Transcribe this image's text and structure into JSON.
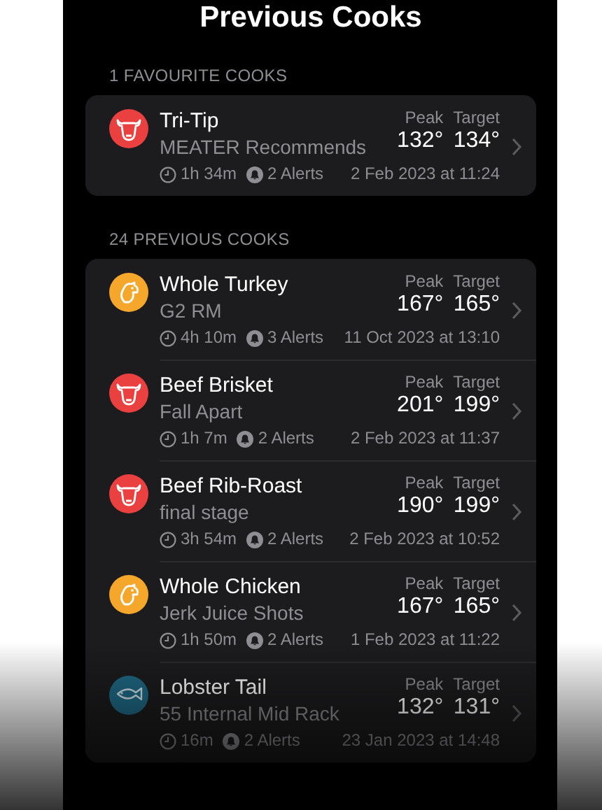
{
  "title": "Previous Cooks",
  "sections": [
    {
      "heading": "1 FAVOURITE COOKS",
      "cooks": [
        {
          "kind": "beef",
          "name": "Tri-Tip",
          "subtitle": "MEATER Recommends",
          "peak_label": "Peak",
          "peak": "132°",
          "target_label": "Target",
          "target": "134°",
          "duration": "1h 34m",
          "alerts": "2 Alerts",
          "date": "2 Feb 2023 at 11:24"
        }
      ]
    },
    {
      "heading": "24 PREVIOUS COOKS",
      "cooks": [
        {
          "kind": "poultry",
          "name": "Whole Turkey",
          "subtitle": "G2 RM",
          "peak_label": "Peak",
          "peak": "167°",
          "target_label": "Target",
          "target": "165°",
          "duration": "4h 10m",
          "alerts": "3 Alerts",
          "date": "11 Oct 2023 at 13:10"
        },
        {
          "kind": "beef",
          "name": "Beef Brisket",
          "subtitle": "Fall Apart",
          "peak_label": "Peak",
          "peak": "201°",
          "target_label": "Target",
          "target": "199°",
          "duration": "1h 7m",
          "alerts": "2 Alerts",
          "date": "2 Feb 2023 at 11:37"
        },
        {
          "kind": "beef",
          "name": "Beef Rib-Roast",
          "subtitle": "final stage",
          "peak_label": "Peak",
          "peak": "190°",
          "target_label": "Target",
          "target": "199°",
          "duration": "3h 54m",
          "alerts": "2 Alerts",
          "date": "2 Feb 2023 at 10:52"
        },
        {
          "kind": "poultry",
          "name": "Whole Chicken",
          "subtitle": "Jerk Juice Shots",
          "peak_label": "Peak",
          "peak": "167°",
          "target_label": "Target",
          "target": "165°",
          "duration": "1h 50m",
          "alerts": "2 Alerts",
          "date": "1 Feb 2023 at 11:22"
        },
        {
          "kind": "fish",
          "name": "Lobster Tail",
          "subtitle": "55 Internal Mid Rack",
          "peak_label": "Peak",
          "peak": "132°",
          "target_label": "Target",
          "target": "131°",
          "duration": "16m",
          "alerts": "2 Alerts",
          "date": "23 Jan 2023 at 14:48"
        }
      ]
    }
  ]
}
